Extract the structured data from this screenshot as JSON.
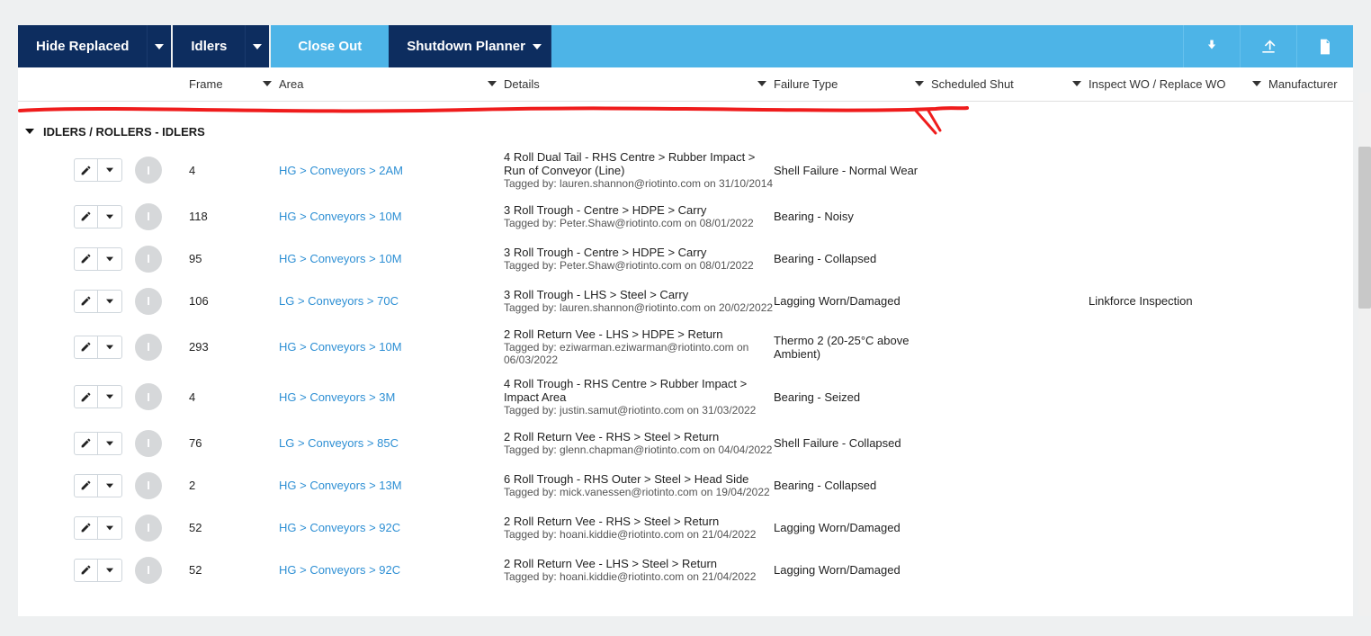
{
  "toolbar": {
    "hide_replaced": "Hide Replaced",
    "idlers": "Idlers",
    "close_out": "Close Out",
    "shutdown_planner": "Shutdown Planner"
  },
  "columns": {
    "frame": "Frame",
    "area": "Area",
    "details": "Details",
    "failure_type": "Failure Type",
    "scheduled_shut": "Scheduled Shut",
    "inspect_wo": "Inspect WO / Replace WO",
    "manufacturer": "Manufacturer"
  },
  "group_header": "IDLERS / ROLLERS - IDLERS",
  "badge_letter": "I",
  "rows": [
    {
      "frame": "4",
      "area": "HG > Conveyors > 2AM",
      "details": "4 Roll Dual Tail - RHS Centre > Rubber Impact > Run of Conveyor (Line)",
      "tagged": "Tagged by: lauren.shannon@riotinto.com on 31/10/2014",
      "failure": "Shell Failure - Normal Wear",
      "wo": ""
    },
    {
      "frame": "118",
      "area": "HG > Conveyors > 10M",
      "details": "3 Roll Trough - Centre > HDPE > Carry",
      "tagged": "Tagged by: Peter.Shaw@riotinto.com on 08/01/2022",
      "failure": "Bearing - Noisy",
      "wo": ""
    },
    {
      "frame": "95",
      "area": "HG > Conveyors > 10M",
      "details": "3 Roll Trough - Centre > HDPE > Carry",
      "tagged": "Tagged by: Peter.Shaw@riotinto.com on 08/01/2022",
      "failure": "Bearing - Collapsed",
      "wo": ""
    },
    {
      "frame": "106",
      "area": "LG > Conveyors > 70C",
      "details": "3 Roll Trough - LHS > Steel > Carry",
      "tagged": "Tagged by: lauren.shannon@riotinto.com on 20/02/2022",
      "failure": "Lagging Worn/Damaged",
      "wo": "Linkforce Inspection"
    },
    {
      "frame": "293",
      "area": "HG > Conveyors > 10M",
      "details": "2 Roll Return Vee - LHS > HDPE > Return",
      "tagged": "Tagged by: eziwarman.eziwarman@riotinto.com on 06/03/2022",
      "failure": "Thermo 2 (20-25°C above Ambient)",
      "wo": ""
    },
    {
      "frame": "4",
      "area": "HG > Conveyors > 3M",
      "details": "4 Roll Trough - RHS Centre > Rubber Impact > Impact Area",
      "tagged": "Tagged by: justin.samut@riotinto.com on 31/03/2022",
      "failure": "Bearing - Seized",
      "wo": ""
    },
    {
      "frame": "76",
      "area": "LG > Conveyors > 85C",
      "details": "2 Roll Return Vee - RHS > Steel > Return",
      "tagged": "Tagged by: glenn.chapman@riotinto.com on 04/04/2022",
      "failure": "Shell Failure - Collapsed",
      "wo": ""
    },
    {
      "frame": "2",
      "area": "HG > Conveyors > 13M",
      "details": "6 Roll Trough - RHS Outer > Steel > Head Side",
      "tagged": "Tagged by: mick.vanessen@riotinto.com on 19/04/2022",
      "failure": "Bearing - Collapsed",
      "wo": ""
    },
    {
      "frame": "52",
      "area": "HG > Conveyors > 92C",
      "details": "2 Roll Return Vee - RHS > Steel > Return",
      "tagged": "Tagged by: hoani.kiddie@riotinto.com on 21/04/2022",
      "failure": "Lagging Worn/Damaged",
      "wo": ""
    },
    {
      "frame": "52",
      "area": "HG > Conveyors > 92C",
      "details": "2 Roll Return Vee - LHS > Steel > Return",
      "tagged": "Tagged by: hoani.kiddie@riotinto.com on 21/04/2022",
      "failure": "Lagging Worn/Damaged",
      "wo": ""
    }
  ]
}
